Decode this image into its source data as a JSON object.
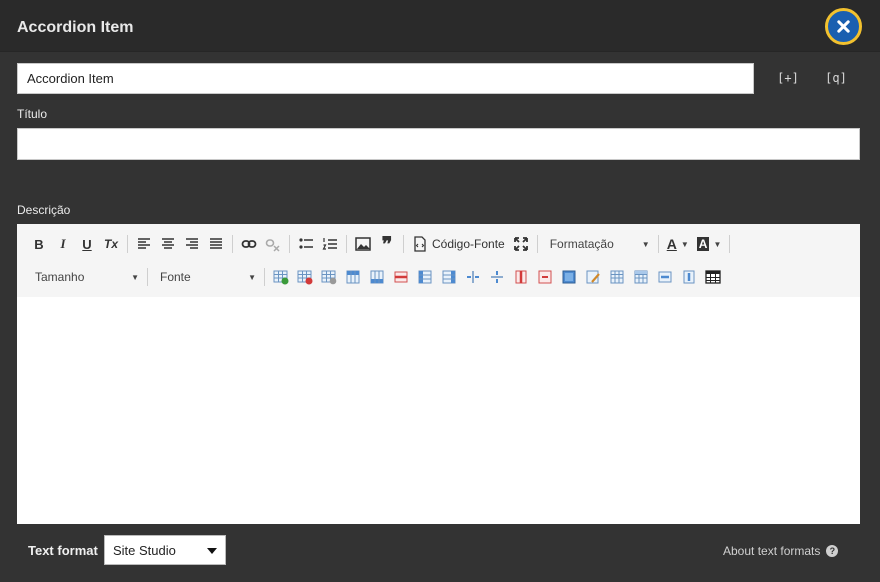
{
  "dialog": {
    "title": "Accordion Item",
    "close_icon": "close-icon"
  },
  "form": {
    "admin_label_value": "Accordion Item",
    "expand_button": "[+]",
    "inspect_button": "[q]",
    "title_label": "Título",
    "title_value": "",
    "description_label": "Descrição"
  },
  "toolbar": {
    "row1": [
      {
        "name": "bold-button",
        "icon": "bold-icon",
        "glyph": "B"
      },
      {
        "name": "italic-button",
        "icon": "italic-icon",
        "glyph": "I"
      },
      {
        "name": "underline-button",
        "icon": "underline-icon",
        "glyph": "U"
      },
      {
        "name": "remove-format-button",
        "icon": "remove-format-icon",
        "glyph": "Tx"
      }
    ],
    "source_label": "Código-Fonte",
    "format_combo": "Formatação",
    "size_combo": "Tamanho",
    "font_combo": "Fonte",
    "text_color_glyph": "A",
    "bg_color_glyph": "A"
  },
  "footer": {
    "text_format_label": "Text format",
    "text_format_selected": "Site Studio",
    "about_link": "About text formats",
    "help_glyph": "?"
  },
  "colors": {
    "accent_ring": "#f2c12e",
    "close_fill": "#1a5fb0",
    "background": "#333333"
  }
}
